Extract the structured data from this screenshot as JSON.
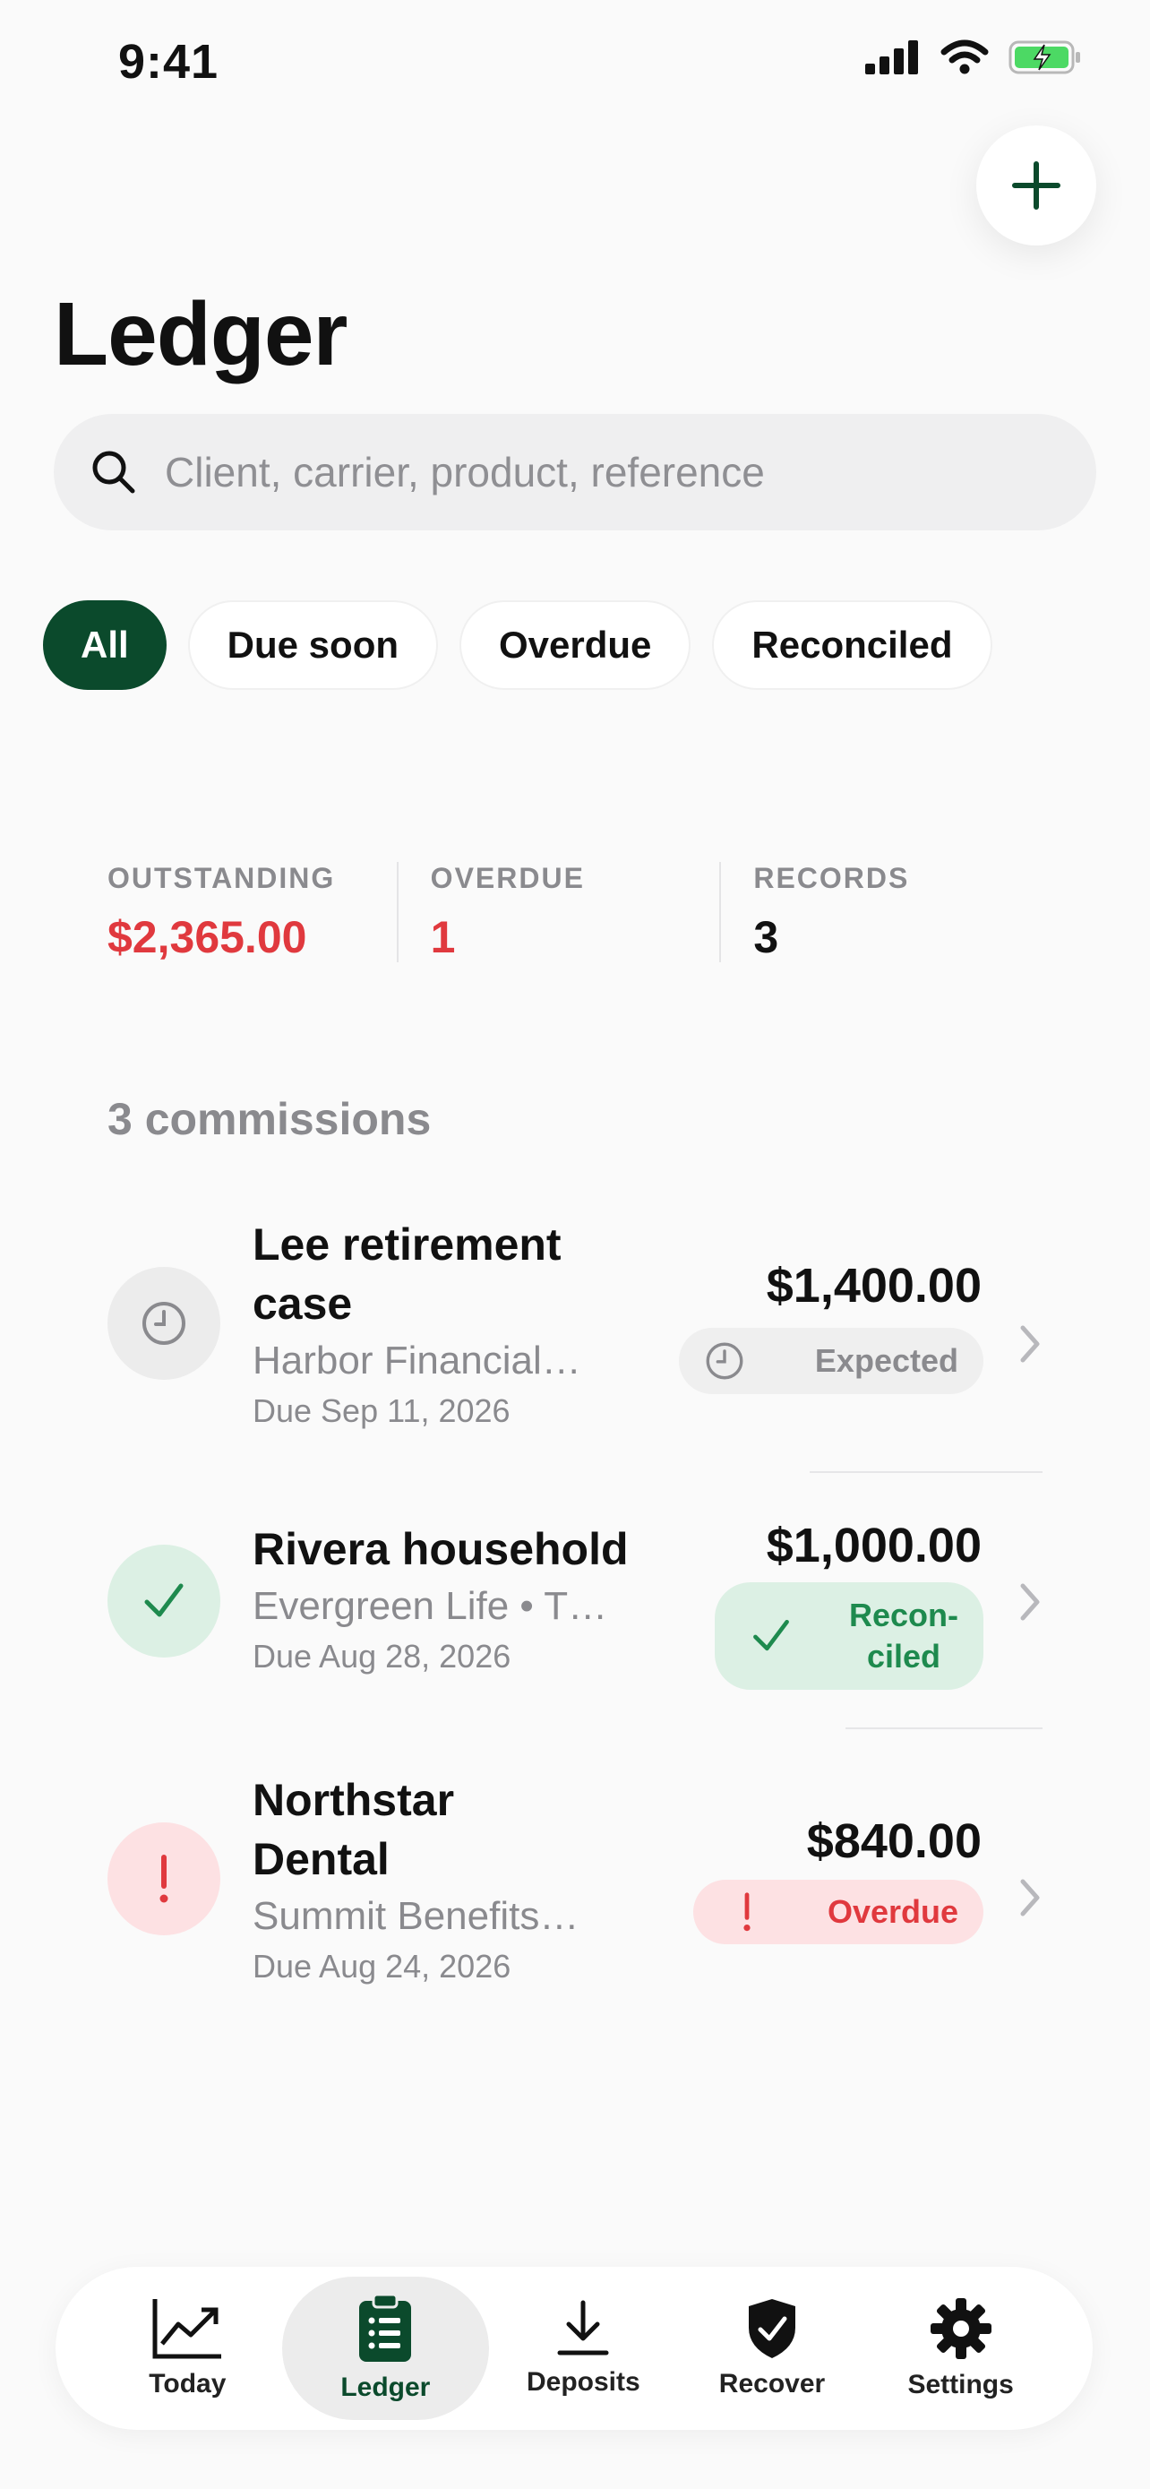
{
  "status_bar": {
    "time": "9:41"
  },
  "header": {
    "title": "Ledger",
    "add_icon": "plus-icon"
  },
  "search": {
    "placeholder": "Client, carrier, product, reference",
    "value": ""
  },
  "filters": [
    {
      "label": "All",
      "selected": true
    },
    {
      "label": "Due soon",
      "selected": false
    },
    {
      "label": "Overdue",
      "selected": false
    },
    {
      "label": "Reconciled",
      "selected": false
    }
  ],
  "summary": {
    "outstanding": {
      "label": "OUTSTANDING",
      "value": "$2,365.00"
    },
    "overdue": {
      "label": "OVERDUE",
      "value": "1"
    },
    "records": {
      "label": "RECORDS",
      "value": "3"
    }
  },
  "list": {
    "count_label": "3 commissions",
    "items": [
      {
        "title": "Lee retirement case",
        "subtitle": "Harbor Financial…",
        "due": "Due Sep 11, 2026",
        "amount": "$1,400.00",
        "status": "Expected",
        "status_icon": "clock-icon"
      },
      {
        "title": "Rivera household",
        "subtitle": "Evergreen Life • T…",
        "due": "Due Aug 28, 2026",
        "amount": "$1,000.00",
        "status": "Recon-\nciled",
        "status_icon": "check-icon"
      },
      {
        "title": "Northstar Dental",
        "subtitle": "Summit Benefits…",
        "due": "Due Aug 24, 2026",
        "amount": "$840.00",
        "status": "Overdue",
        "status_icon": "exclamation-icon"
      }
    ]
  },
  "colors": {
    "brand": "#0b4a2c",
    "danger": "#e0393e",
    "success": "#1e8a4e",
    "muted": "#8a8a8e"
  },
  "tabbar": {
    "tabs": [
      {
        "label": "Today",
        "icon": "chart-icon"
      },
      {
        "label": "Ledger",
        "icon": "clipboard-list-icon",
        "active": true
      },
      {
        "label": "Deposits",
        "icon": "download-icon"
      },
      {
        "label": "Recover",
        "icon": "shield-check-icon"
      },
      {
        "label": "Settings",
        "icon": "gear-icon"
      }
    ]
  }
}
